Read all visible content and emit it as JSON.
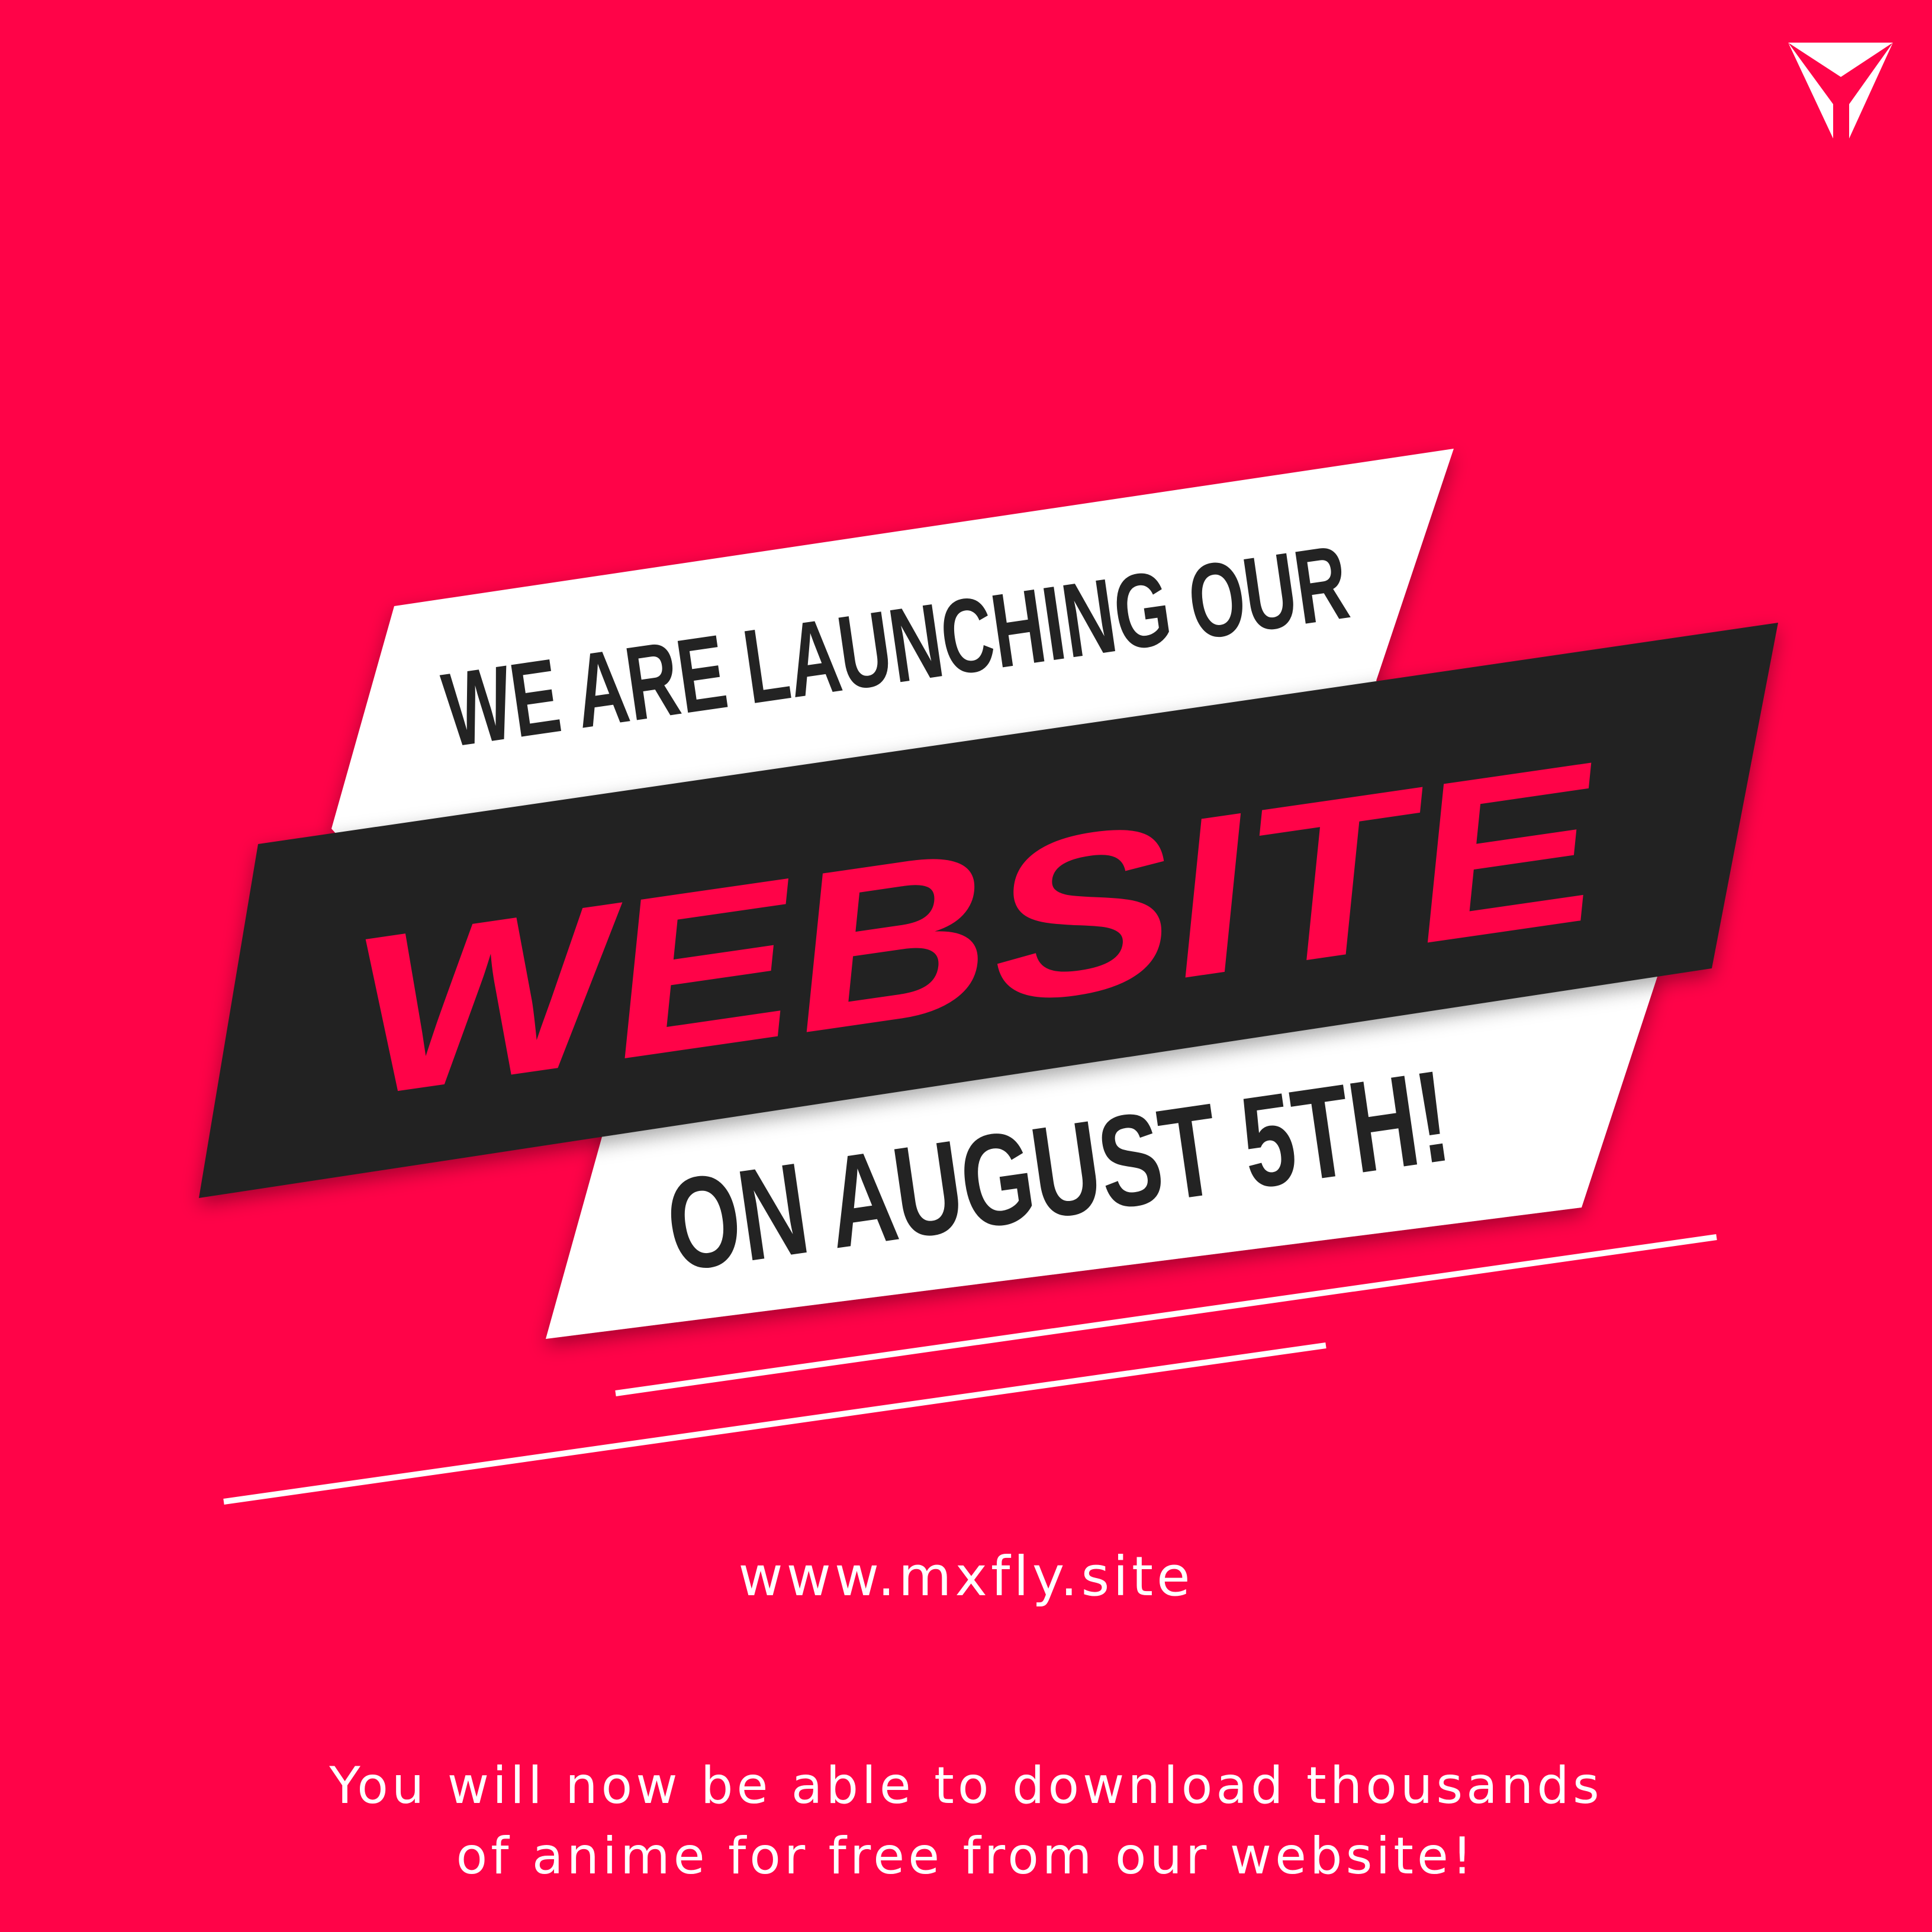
{
  "brand": {
    "logo_icon": "y-triangle-logo-icon"
  },
  "headline": {
    "line1": "WE ARE LAUNCHING OUR",
    "line2": "WEBSITE",
    "line3": "ON AUGUST 5TH!"
  },
  "url": "www.mxfly.site",
  "tagline": {
    "line1": "You will now be able to download thousands",
    "line2": "of anime for free from our website!"
  },
  "colors": {
    "background": "#ff0348",
    "banner_white": "#ffffff",
    "banner_dark": "#232323",
    "accent_text": "#ff0348",
    "dark_text": "#232323"
  }
}
